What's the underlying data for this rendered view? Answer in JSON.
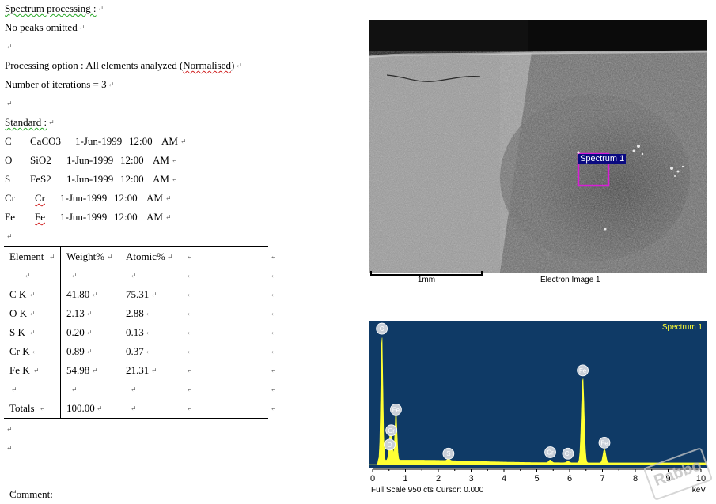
{
  "report": {
    "spectrum_processing": "Spectrum processing :",
    "no_peaks": "No peaks omitted",
    "processing_prefix": "Processing option : All elements analyzed (",
    "processing_word": "Normalised",
    "processing_suffix": ")",
    "iterations": "Number of iterations = 3",
    "standard_label": "Standard :",
    "standards": [
      {
        "el": "C",
        "std": "CaCO3",
        "date": "1-Jun-1999",
        "time": "12:00",
        "ampm": "AM"
      },
      {
        "el": "O",
        "std": "SiO2",
        "date": "1-Jun-1999",
        "time": "12:00",
        "ampm": "AM"
      },
      {
        "el": "S",
        "std": "FeS2",
        "date": "1-Jun-1999",
        "time": "12:00",
        "ampm": "AM"
      },
      {
        "el": "Cr",
        "std": "Cr",
        "date": "1-Jun-1999",
        "time": "12:00",
        "ampm": "AM"
      },
      {
        "el": "Fe",
        "std": "Fe",
        "date": "1-Jun-1999",
        "time": "12:00",
        "ampm": "AM"
      }
    ]
  },
  "table": {
    "headers": [
      "Element",
      "Weight%",
      "Atomic%"
    ],
    "rows": [
      {
        "element": "C K",
        "weight": "41.80",
        "atomic": "75.31"
      },
      {
        "element": "O K",
        "weight": "2.13",
        "atomic": "2.88"
      },
      {
        "element": "S K",
        "weight": "0.20",
        "atomic": "0.13"
      },
      {
        "element": "Cr K",
        "weight": "0.89",
        "atomic": "0.37"
      },
      {
        "element": "Fe K",
        "weight": "54.98",
        "atomic": "21.31"
      }
    ],
    "totals_label": "Totals",
    "totals_value": "100.00"
  },
  "comment_label": "Comment:",
  "electron_image": {
    "caption": "Electron Image 1",
    "scale_label": "1mm",
    "spectrum_box_label": "Spectrum 1",
    "box_color": "#d61fd6"
  },
  "spectrum": {
    "title": "Spectrum 1",
    "background": "#0f3a66",
    "trace_color": "#ffff33",
    "x_ticks": [
      "0",
      "1",
      "2",
      "3",
      "4",
      "5",
      "6",
      "7",
      "8",
      "9",
      "10"
    ],
    "x_unit": "keV",
    "footer": "Full Scale 950 cts Cursor: 0.000",
    "peaks": [
      {
        "label": "C",
        "kev": 0.28,
        "height": 0.92
      },
      {
        "label": "O",
        "kev": 0.52,
        "height": 0.12
      },
      {
        "label": "Cr",
        "kev": 0.57,
        "height": 0.2
      },
      {
        "label": "Fe",
        "kev": 0.71,
        "height": 0.35
      },
      {
        "label": "S",
        "kev": 2.31,
        "height": 0.01
      },
      {
        "label": "Cr",
        "kev": 5.41,
        "height": 0.02
      },
      {
        "label": "Cr",
        "kev": 5.95,
        "height": 0.01
      },
      {
        "label": "Fe",
        "kev": 6.4,
        "height": 0.62
      },
      {
        "label": "Fe",
        "kev": 7.06,
        "height": 0.1
      }
    ]
  },
  "watermark": "Rabbo"
}
